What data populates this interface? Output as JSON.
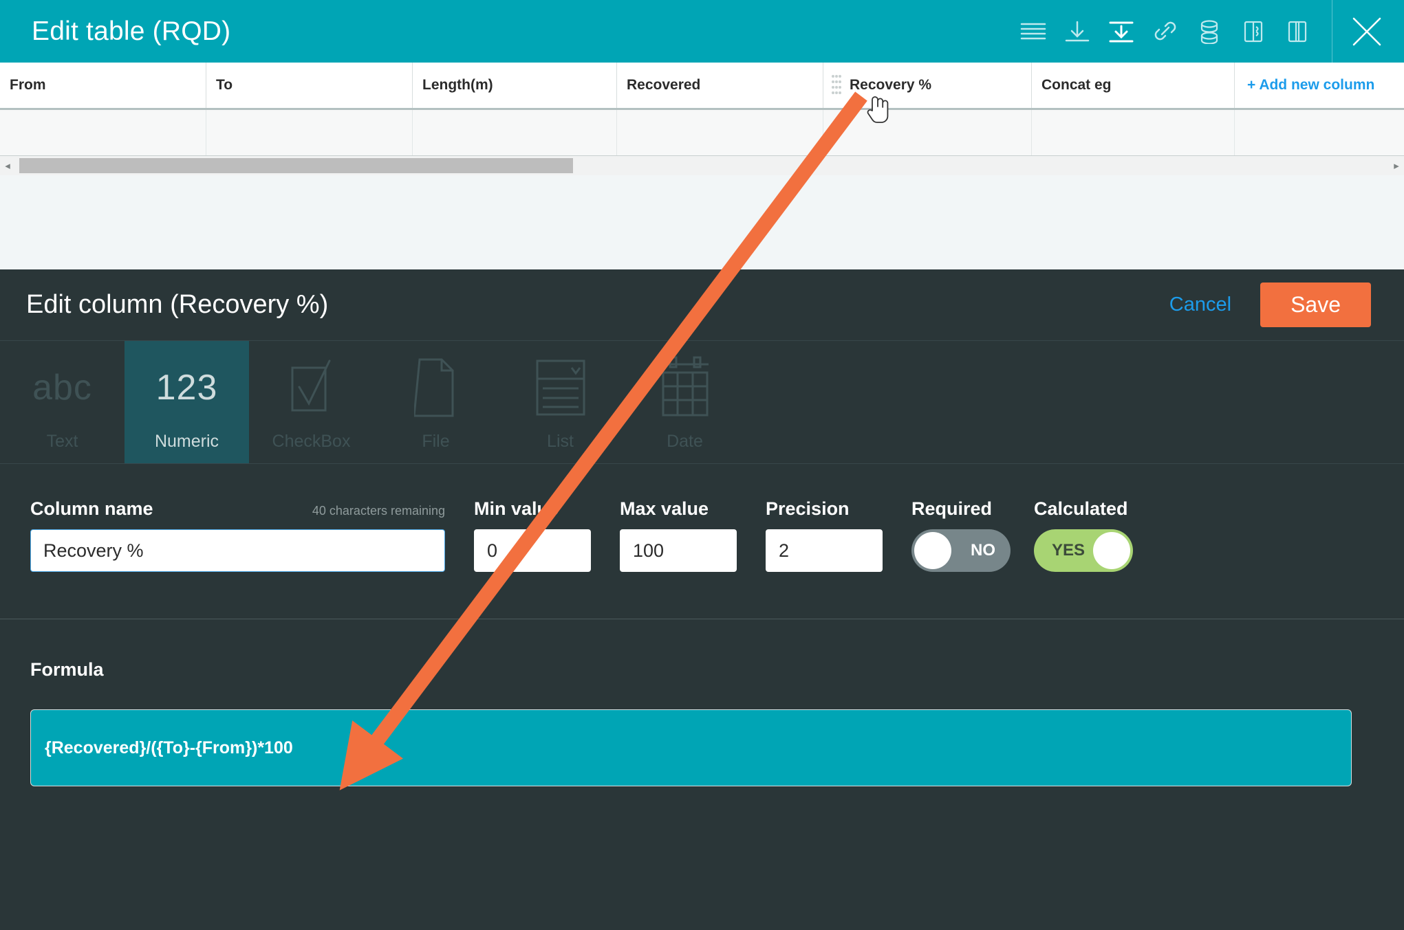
{
  "window": {
    "title": "Edit table (RQD)",
    "toolbar_icons": [
      {
        "name": "list-lines-icon",
        "label": "Bulk edit"
      },
      {
        "name": "download-icon",
        "label": "Download"
      },
      {
        "name": "import-icon",
        "label": "Import"
      },
      {
        "name": "link-icon",
        "label": "Link"
      },
      {
        "name": "database-icon",
        "label": "Database"
      },
      {
        "name": "merge-columns-icon",
        "label": "Merge columns"
      },
      {
        "name": "split-columns-icon",
        "label": "Split columns"
      }
    ],
    "close_label": "Close"
  },
  "table": {
    "columns": [
      {
        "label": "From",
        "has_drag_handle": false,
        "add_new": false
      },
      {
        "label": "To",
        "has_drag_handle": false,
        "add_new": false
      },
      {
        "label": "Length(m)",
        "has_drag_handle": false,
        "add_new": false
      },
      {
        "label": "Recovered",
        "has_drag_handle": false,
        "add_new": false
      },
      {
        "label": "Recovery %",
        "has_drag_handle": true,
        "add_new": false
      },
      {
        "label": "Concat eg",
        "has_drag_handle": false,
        "add_new": false
      },
      {
        "label": "+ Add new column",
        "has_drag_handle": false,
        "add_new": true
      }
    ],
    "rows": [
      [
        "",
        "",
        "",
        "",
        "",
        "",
        ""
      ]
    ],
    "scrollbar": {
      "left_arrow": "◂",
      "right_arrow": "▸"
    }
  },
  "edit_column": {
    "title": "Edit column (Recovery %)",
    "cancel_label": "Cancel",
    "save_label": "Save",
    "types": [
      {
        "label": "Text",
        "icon": "abc-icon",
        "glyph": "abc",
        "active": false
      },
      {
        "label": "Numeric",
        "icon": "123-icon",
        "glyph": "123",
        "active": true
      },
      {
        "label": "CheckBox",
        "icon": "checkbox-icon",
        "glyph": "",
        "active": false
      },
      {
        "label": "File",
        "icon": "file-icon",
        "glyph": "",
        "active": false
      },
      {
        "label": "List",
        "icon": "list-icon",
        "glyph": "",
        "active": false
      },
      {
        "label": "Date",
        "icon": "date-icon",
        "glyph": "",
        "active": false
      }
    ],
    "fields": {
      "column_name": {
        "label": "Column name",
        "hint": "40 characters remaining",
        "value": "Recovery %",
        "placeholder": ""
      },
      "min_value": {
        "label": "Min value",
        "value": "0",
        "placeholder": ""
      },
      "max_value": {
        "label": "Max value",
        "value": "100",
        "placeholder": ""
      },
      "precision": {
        "label": "Precision",
        "value": "2",
        "placeholder": ""
      },
      "required": {
        "label": "Required",
        "value": "NO",
        "on": false
      },
      "calculated": {
        "label": "Calculated",
        "value": "YES",
        "on": true
      }
    },
    "formula": {
      "label": "Formula",
      "value": "{Recovered}/({To}-{From})*100"
    }
  },
  "annotation": {
    "arrow_color": "#f2703f",
    "description": "arrow from Recovery % column header to Formula box"
  },
  "colors": {
    "teal": "#00a5b5",
    "panel_dark": "#2a3638",
    "tile_active": "#1f565f",
    "save_orange": "#f2703f",
    "link_blue": "#1c9ceb",
    "toggle_on": "#a8d473",
    "toggle_off": "#77868a"
  }
}
